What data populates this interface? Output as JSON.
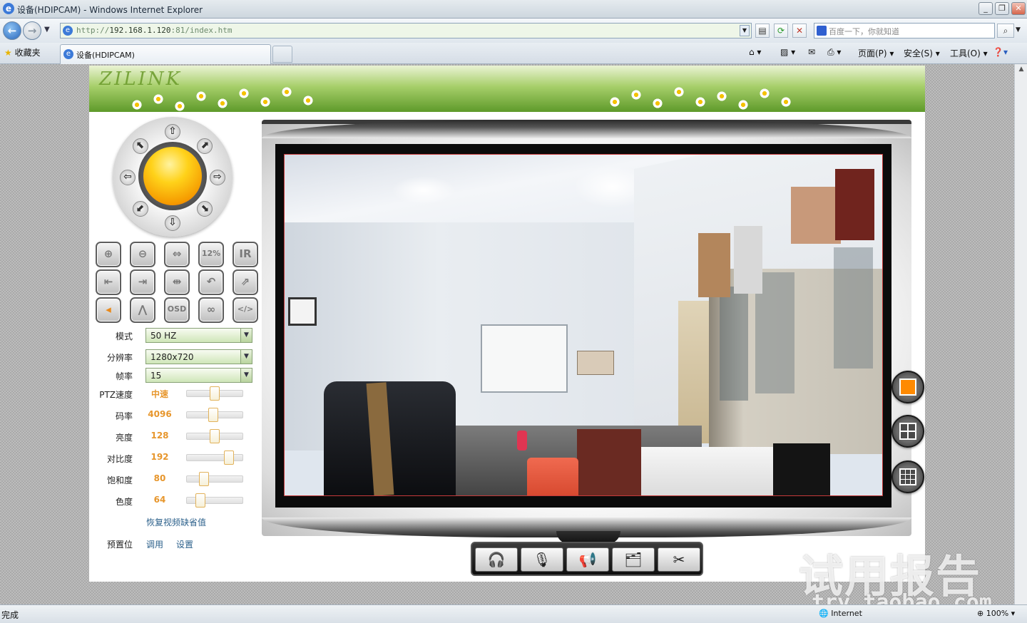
{
  "window": {
    "title": "设备(HDIPCAM) - Windows Internet Explorer",
    "min_glyph": "_",
    "max_glyph": "❐",
    "close_glyph": "✕"
  },
  "address": {
    "url_prefix": "http://",
    "url_host": "192.168.1.120",
    "url_rest": ":81/index.htm",
    "search_placeholder": "百度一下，你就知道"
  },
  "tabs": {
    "favorites": "收藏夹",
    "active_tab": "设备(HDIPCAM)",
    "page_menu": "页面(P)",
    "safety_menu": "安全(S)",
    "tools_menu": "工具(O)"
  },
  "banner": {
    "logo": "ZILINK"
  },
  "controls": {
    "buttons": [
      "zoom-in",
      "zoom-out",
      "flip-h",
      "fps",
      "ir",
      "left-limit",
      "right-limit",
      "h-patrol",
      "return",
      "vflip-off",
      "prev",
      "v-patrol",
      "osd",
      "loop",
      "code"
    ],
    "button_glyphs": [
      "⊕",
      "⊖",
      "⇔",
      "12%",
      "IR",
      "⇤",
      "⇥",
      "⇹",
      "↶",
      "⇗",
      "◂",
      "⋀",
      "OSD",
      "∞",
      "</>"
    ],
    "mode_label": "模式",
    "mode_value": "50 HZ",
    "resolution_label": "分辨率",
    "resolution_value": "1280x720",
    "fps_label": "帧率",
    "fps_value": "15",
    "sliders": [
      {
        "label": "PTZ速度",
        "value": "中速",
        "level": 0.5
      },
      {
        "label": "码率",
        "value": "4096",
        "level": 0.48
      },
      {
        "label": "亮度",
        "value": "128",
        "level": 0.5
      },
      {
        "label": "对比度",
        "value": "192",
        "level": 0.75
      },
      {
        "label": "饱和度",
        "value": "80",
        "level": 0.31
      },
      {
        "label": "色度",
        "value": "64",
        "level": 0.25
      }
    ],
    "restore_default": "恢复视频缺省值",
    "preset_label": "预置位",
    "preset_call": "调用",
    "preset_set": "设置"
  },
  "toolbar_glyphs": [
    "🎧",
    "🎙",
    "📢",
    "🗂",
    "✂"
  ],
  "status": {
    "text": "完成",
    "zone": "Internet",
    "zoom": "100%"
  },
  "watermark": {
    "main": "试用报告",
    "sub": "try.taobao.com"
  }
}
